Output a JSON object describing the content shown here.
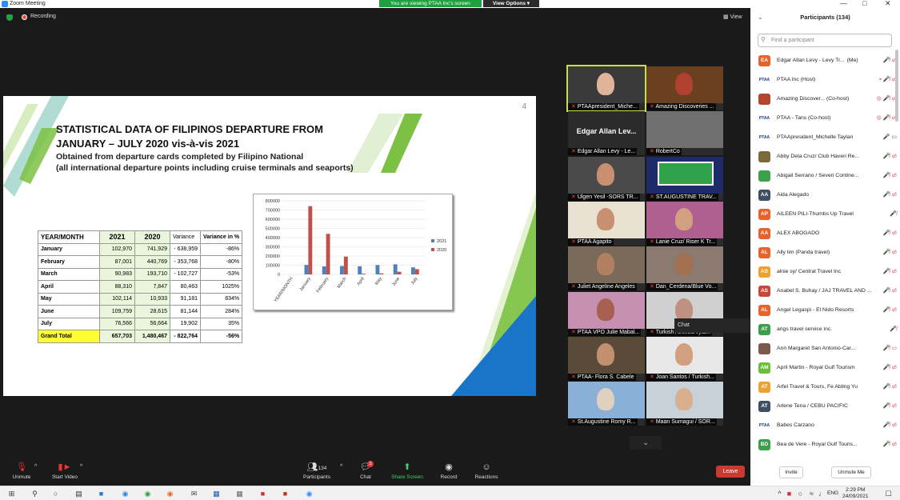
{
  "window": {
    "title": "Zoom Meeting",
    "recording_label": "Recording",
    "view_label": "View"
  },
  "share_banner": {
    "text": "You are viewing PTAA Inc's screen",
    "view_options": "View Options"
  },
  "slide": {
    "page_number": "4",
    "title_line1": "STATISTICAL DATA OF FILIPINOS DEPARTURE FROM",
    "title_line2": "JANUARY – JULY 2020 vis-à-vis 2021",
    "subtitle_line1": "Obtained from departure cards completed by Filipino National",
    "subtitle_line2": "(all international departure points including cruise terminals and seaports)",
    "table": {
      "headers": [
        "YEAR/MONTH",
        "2021",
        "2020",
        "Variance",
        "Variance in %"
      ],
      "rows": [
        [
          "January",
          "102,970",
          "741,929",
          "- 638,959",
          "-86%"
        ],
        [
          "February",
          "87,001",
          "440,769",
          "- 353,768",
          "-80%"
        ],
        [
          "March",
          "90,983",
          "193,710",
          "- 102,727",
          "-53%"
        ],
        [
          "April",
          "88,310",
          "7,847",
          "80,463",
          "1025%"
        ],
        [
          "May",
          "102,114",
          "10,933",
          "91,181",
          "834%"
        ],
        [
          "June",
          "109,759",
          "28,615",
          "81,144",
          "284%"
        ],
        [
          "July",
          "76,566",
          "56,664",
          "19,902",
          "35%"
        ],
        [
          "Grand Total",
          "657,703",
          "1,480,467",
          "- 822,764",
          "-56%"
        ]
      ]
    },
    "chart_data": {
      "type": "bar",
      "categories": [
        "YEAR/MONTH",
        "January",
        "February",
        "March",
        "April",
        "May",
        "June",
        "July"
      ],
      "series": [
        {
          "name": "2021",
          "color": "#4f81bd",
          "values": [
            0,
            102970,
            87001,
            90983,
            88310,
            102114,
            109759,
            76566
          ]
        },
        {
          "name": "2020",
          "color": "#c0504d",
          "values": [
            0,
            741929,
            440769,
            193710,
            7847,
            10933,
            28615,
            56664
          ]
        }
      ],
      "ylim": [
        0,
        800000
      ],
      "yticks": [
        "800000",
        "700000",
        "600000",
        "500000",
        "400000",
        "300000",
        "200000",
        "100000",
        "0"
      ],
      "legend": "right",
      "grid": true
    }
  },
  "gallery": {
    "tiles": [
      {
        "name": "PTAApresident_Miche...",
        "kind": "video",
        "bg": "#3a3a3a",
        "skin": "#e0b49a"
      },
      {
        "name": "Amazing Discoveries ...",
        "kind": "video",
        "bg": "#6a4020",
        "skin": "#b04030"
      },
      {
        "name": "Edgar Allan Levy - Le...",
        "kind": "name",
        "label": "Edgar Allan Lev..."
      },
      {
        "name": "RobertCo",
        "kind": "blank",
        "bg": "#6f6f6f"
      },
      {
        "name": "Ulgen Yesil -SORS TR...",
        "kind": "video",
        "bg": "#4a4a4a",
        "skin": "#c89070"
      },
      {
        "name": "ST.AUGUSTINE TRAV...",
        "kind": "logo",
        "bg": "#1d2b6b"
      },
      {
        "name": "PTAA Agapito",
        "kind": "video",
        "bg": "#e8e0d0",
        "skin": "#c88f70"
      },
      {
        "name": "Lanie Cruz/ Riser K Tr...",
        "kind": "video",
        "bg": "#b06090",
        "skin": "#d0a080"
      },
      {
        "name": "Juliet Angeline Angeles",
        "kind": "video",
        "bg": "#7a6a5a",
        "skin": "#b08060"
      },
      {
        "name": "Dan_Cerdena/Blue Vo...",
        "kind": "video",
        "bg": "#8a7a70",
        "skin": "#a07050"
      },
      {
        "name": "PTAA VPO Julie Mabal...",
        "kind": "video",
        "bg": "#c890b0",
        "skin": "#a86050"
      },
      {
        "name": "Turkish Airlines/Vyla...",
        "kind": "video",
        "bg": "#d0d0d0",
        "skin": "#c09080"
      },
      {
        "name": "PTAA- Flora S. Cabele",
        "kind": "video",
        "bg": "#5a4a3a",
        "skin": "#c09070"
      },
      {
        "name": "Joan Santos / Turkish...",
        "kind": "video",
        "bg": "#e8e8e8",
        "skin": "#d0a080"
      },
      {
        "name": "St.Augustine Romy R...",
        "kind": "video",
        "bg": "#8ab0d8",
        "skin": "#e0d0c0"
      },
      {
        "name": "Maan Sumagui / SOR...",
        "kind": "video",
        "bg": "#c8d0d8",
        "skin": "#d8b090"
      }
    ],
    "chat_tooltip": "Chat"
  },
  "toolbar": {
    "unmute": "Unmute",
    "start_video": "Start Video",
    "participants": "Participants",
    "participants_count": "134",
    "chat": "Chat",
    "chat_badge": "3",
    "share_screen": "Share Screen",
    "record": "Record",
    "reactions": "Reactions",
    "leave": "Leave"
  },
  "panel": {
    "title": "Participants (134)",
    "search_placeholder": "Find a participant",
    "invite": "Invite",
    "unmute_me": "Unmute Me",
    "participants": [
      {
        "initials": "EA",
        "color": "#e8632b",
        "name": "Edgar Allan Levy - Levy Tr...",
        "tag": "(Me)",
        "icons": "🎤̸ ▭̸"
      },
      {
        "initials": "PTAA",
        "color": "#ffffff",
        "name": "PTAA Inc (Host)",
        "tag": "",
        "icons": "▪ 🎤̸ ▭̸"
      },
      {
        "initials": "",
        "color": "#b5442e",
        "name": "Amazing Discover... (Co-host)",
        "tag": "",
        "icons": "◎ 🎤̸ ▭̸"
      },
      {
        "initials": "PTAA",
        "color": "#ffffff",
        "name": "PTAA - Tans (Co-host)",
        "tag": "",
        "icons": "◎ 🎤̸ ▭̸"
      },
      {
        "initials": "PTAA",
        "color": "#ffffff",
        "name": "PTAApresident_Michelle Taylan",
        "tag": "",
        "icons": "🎤 ▭"
      },
      {
        "initials": "",
        "color": "#7a6a3a",
        "name": "Abby Dela Cruz/ Club Haven Re...",
        "tag": "",
        "icons": "🎤̸ ▭̸"
      },
      {
        "initials": "",
        "color": "#3aa04a",
        "name": "Abigail Serrano / Seven Contine...",
        "tag": "",
        "icons": "🎤̸ ▭̸"
      },
      {
        "initials": "AA",
        "color": "#3d4f63",
        "name": "Aida Alegado",
        "tag": "",
        "icons": "🎤̸ ▭̸"
      },
      {
        "initials": "AP",
        "color": "#e8632b",
        "name": "AILEEN PILI-Thumbs Up Travel",
        "tag": "",
        "icons": "🎤̸"
      },
      {
        "initials": "AA",
        "color": "#e8632b",
        "name": "ALEX ABOGADO",
        "tag": "",
        "icons": "🎤̸ ▭̸"
      },
      {
        "initials": "AL",
        "color": "#e8632b",
        "name": "Ally lim  (Panda travel)",
        "tag": "",
        "icons": "🎤̸ ▭̸"
      },
      {
        "initials": "AS",
        "color": "#f0a030",
        "name": "alnie sy/ Central Travel Inc",
        "tag": "",
        "icons": "🎤̸ ▭̸"
      },
      {
        "initials": "AS",
        "color": "#c8463a",
        "name": "Anabel S. Buhay / JAJ TRAVEL AND ...",
        "tag": "",
        "icons": "🎤̸ ▭̸"
      },
      {
        "initials": "AL",
        "color": "#e8632b",
        "name": "Angel Legaspi - El Nido Resorts",
        "tag": "",
        "icons": "🎤̸ ▭̸"
      },
      {
        "initials": "AT",
        "color": "#3aa04a",
        "name": "angs travel service inc.",
        "tag": "",
        "icons": "🎤̸"
      },
      {
        "initials": "",
        "color": "#7a5a4a",
        "name": "Ann Margaret San Antonio-Car...",
        "tag": "",
        "icons": "🎤̸ ▭"
      },
      {
        "initials": "AM",
        "color": "#6cbf3a",
        "name": "April Martin - Royal Gulf Tourism",
        "tag": "",
        "icons": "🎤̸ ▭̸"
      },
      {
        "initials": "AT",
        "color": "#f0a030",
        "name": "Arfel Travel & Tours, Fe Abling Yu",
        "tag": "",
        "icons": "🎤̸ ▭̸"
      },
      {
        "initials": "AT",
        "color": "#3d4f63",
        "name": "Arlene Tena / CEBU PACIFIC",
        "tag": "",
        "icons": "🎤̸ ▭̸"
      },
      {
        "initials": "PTAA",
        "color": "#ffffff",
        "name": "Babes Carzano",
        "tag": "",
        "icons": "🎤̸ ▭̸"
      },
      {
        "initials": "BD",
        "color": "#3aa04a",
        "name": "Bea de Vere - Royal Gulf Touris...",
        "tag": "",
        "icons": "🎤̸ ▭̸"
      }
    ]
  },
  "taskbar": {
    "time": "2:29 PM",
    "date": "24/09/2021",
    "lang": "ENG"
  }
}
